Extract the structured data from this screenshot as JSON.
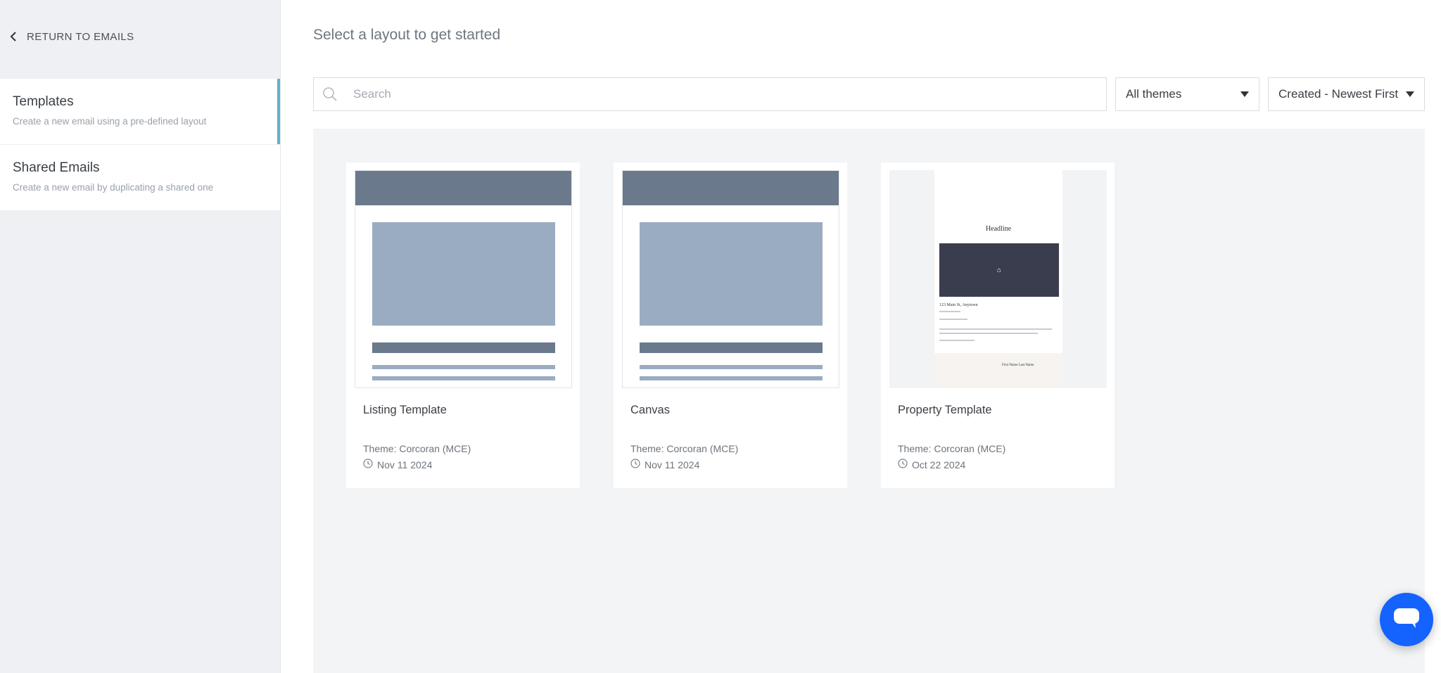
{
  "sidebar": {
    "back_label": "RETURN TO EMAILS",
    "items": [
      {
        "title": "Templates",
        "subtitle": "Create a new email using a pre-defined layout",
        "active": true
      },
      {
        "title": "Shared Emails",
        "subtitle": "Create a new email by duplicating a shared one",
        "active": false
      }
    ]
  },
  "main": {
    "heading": "Select a layout to get started",
    "search": {
      "placeholder": "Search",
      "value": ""
    },
    "theme_filter": {
      "selected": "All themes"
    },
    "sort": {
      "selected": "Created - Newest First"
    }
  },
  "cards": [
    {
      "title": "Listing Template",
      "theme": "Theme: Corcoran (MCE)",
      "date": "Nov 11 2024",
      "preview": "listing-wireframe"
    },
    {
      "title": "Canvas",
      "theme": "Theme: Corcoran (MCE)",
      "date": "Nov 11 2024",
      "preview": "listing-wireframe"
    },
    {
      "title": "Property Template",
      "theme": "Theme: Corcoran (MCE)",
      "date": "Oct 22 2024",
      "preview": "property-email",
      "preview_text": {
        "headline": "Headline",
        "address": "123 Main St, Anytown",
        "agent": "First Name Last Name"
      }
    }
  ],
  "colors": {
    "accent": "#5eb4c4",
    "chat_button": "#1463ff",
    "wireframe_dark": "#6a7a8c",
    "wireframe_light": "#9aacc1"
  },
  "icons": {
    "back": "chevron-left-icon",
    "search": "search-icon",
    "clock": "clock-icon",
    "chat": "chat-bubble-icon",
    "dropdown": "caret-down-icon"
  }
}
